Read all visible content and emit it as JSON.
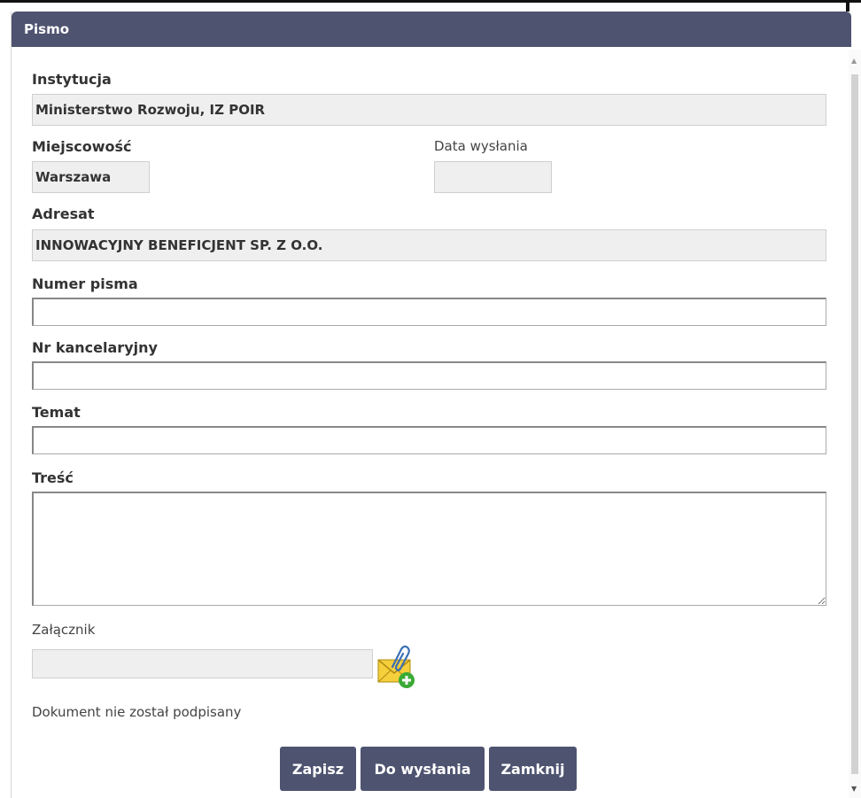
{
  "dialog": {
    "title": "Pismo"
  },
  "form": {
    "instytucja": {
      "label": "Instytucja",
      "value": "Ministerstwo Rozwoju, IZ POIR"
    },
    "miejscowosc": {
      "label": "Miejscowość",
      "value": "Warszawa"
    },
    "data_wyslania": {
      "label": "Data wysłania",
      "value": ""
    },
    "adresat": {
      "label": "Adresat",
      "value": "INNOWACYJNY BENEFICJENT SP. Z O.O."
    },
    "numer_pisma": {
      "label": "Numer pisma",
      "value": ""
    },
    "nr_kancelaryjny": {
      "label": "Nr kancelaryjny",
      "value": ""
    },
    "temat": {
      "label": "Temat",
      "value": ""
    },
    "tresc": {
      "label": "Treść",
      "value": ""
    },
    "zalacznik": {
      "label": "Załącznik",
      "value": ""
    },
    "status": "Dokument nie został podpisany"
  },
  "buttons": {
    "save": "Zapisz",
    "send": "Do wysłania",
    "close": "Zamknij"
  },
  "icons": {
    "attach": "envelope-paperclip-add-icon"
  },
  "colors": {
    "header": "#4e5370",
    "button": "#4e5370",
    "readonly_bg": "#efefef",
    "add_green": "#3aaa35"
  }
}
